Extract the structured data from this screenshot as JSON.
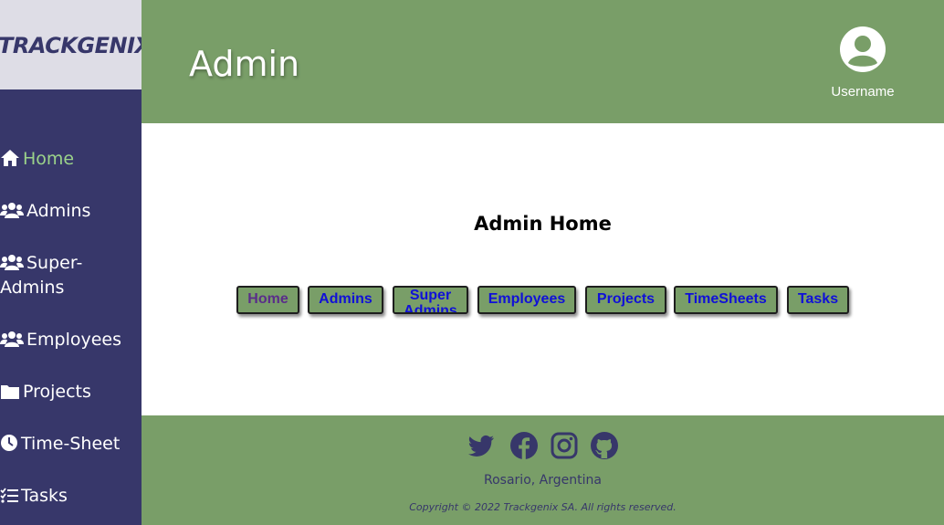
{
  "brand": {
    "logo_text": "TRACKGENIX"
  },
  "colors": {
    "sidebar_bg": "#37376a",
    "logo_bg": "#dedde6",
    "header_bg": "#799e68",
    "active_nav": "#9bd38a",
    "button_text": "#1010d8",
    "button_visited_text": "#5a2d8a"
  },
  "sidebar": {
    "items": [
      {
        "label": "Home",
        "icon": "home-icon",
        "active": true
      },
      {
        "label": "Admins",
        "icon": "users-icon"
      },
      {
        "label": "Super-",
        "label2": "Admins",
        "icon": "users-icon"
      },
      {
        "label": "Employees",
        "icon": "users-icon"
      },
      {
        "label": "Projects",
        "icon": "folder-icon"
      },
      {
        "label": "Time-Sheet",
        "icon": "clock-icon"
      },
      {
        "label": "Tasks",
        "icon": "tasklist-icon"
      }
    ]
  },
  "header": {
    "title": "Admin",
    "user": {
      "name": "Username",
      "icon": "user-circle-icon"
    }
  },
  "main": {
    "title": "Admin Home",
    "buttons": [
      {
        "label": "Home"
      },
      {
        "label": "Admins"
      },
      {
        "label": "Super",
        "label2": "Admins"
      },
      {
        "label": "Employees"
      },
      {
        "label": "Projects"
      },
      {
        "label": "TimeSheets"
      },
      {
        "label": "Tasks"
      }
    ]
  },
  "footer": {
    "socials": [
      "twitter-icon",
      "facebook-icon",
      "instagram-icon",
      "github-icon"
    ],
    "location": "Rosario, Argentina",
    "copyright": "Copyright © 2022 Trackgenix SA. All rights reserved."
  }
}
